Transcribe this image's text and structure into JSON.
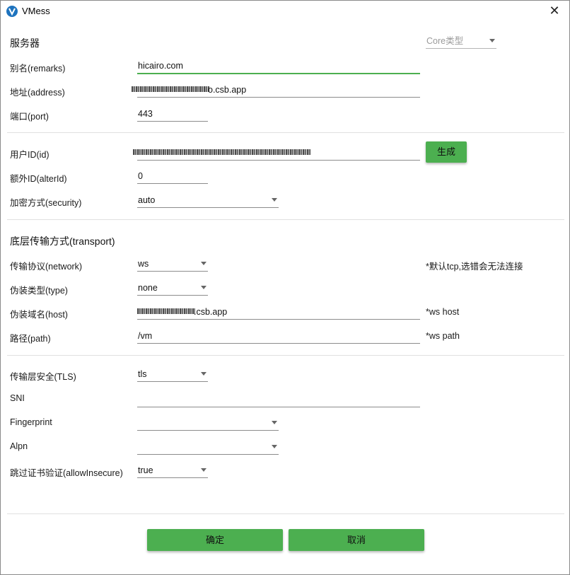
{
  "window": {
    "title": "VMess",
    "close_glyph": "✕"
  },
  "core_type": {
    "placeholder": "Core类型"
  },
  "sections": {
    "server": "服务器",
    "transport": "底层传输方式(transport)"
  },
  "fields": {
    "remarks": {
      "label": "别名(remarks)",
      "value": "hicairo.com"
    },
    "address": {
      "label": "地址(address)",
      "value": "o.csb.app"
    },
    "port": {
      "label": "端口(port)",
      "value": "443"
    },
    "id": {
      "label": "用户ID(id)",
      "value": ""
    },
    "alter_id": {
      "label": "额外ID(alterId)",
      "value": "0"
    },
    "security": {
      "label": "加密方式(security)",
      "value": "auto"
    },
    "network": {
      "label": "传输协议(network)",
      "value": "ws",
      "hint": "*默认tcp,选错会无法连接"
    },
    "type": {
      "label": "伪装类型(type)",
      "value": "none"
    },
    "host": {
      "label": "伪装域名(host)",
      "value": ".csb.app",
      "hint": "*ws host"
    },
    "path": {
      "label": "路径(path)",
      "value": "/vm",
      "hint": "*ws path"
    },
    "tls": {
      "label": "传输层安全(TLS)",
      "value": "tls"
    },
    "sni": {
      "label": "SNI",
      "value": ""
    },
    "fingerprint": {
      "label": "Fingerprint",
      "value": ""
    },
    "alpn": {
      "label": "Alpn",
      "value": ""
    },
    "allow_insecure": {
      "label": "跳过证书验证(allowInsecure)",
      "value": "true"
    }
  },
  "buttons": {
    "generate": "生成",
    "ok": "确定",
    "cancel": "取消"
  },
  "colors": {
    "accent": "#4caf50",
    "app_icon": "#1e73be"
  },
  "icons": {
    "app": "vmess-logo-icon",
    "close": "close-icon",
    "dropdown": "chevron-down-icon"
  }
}
